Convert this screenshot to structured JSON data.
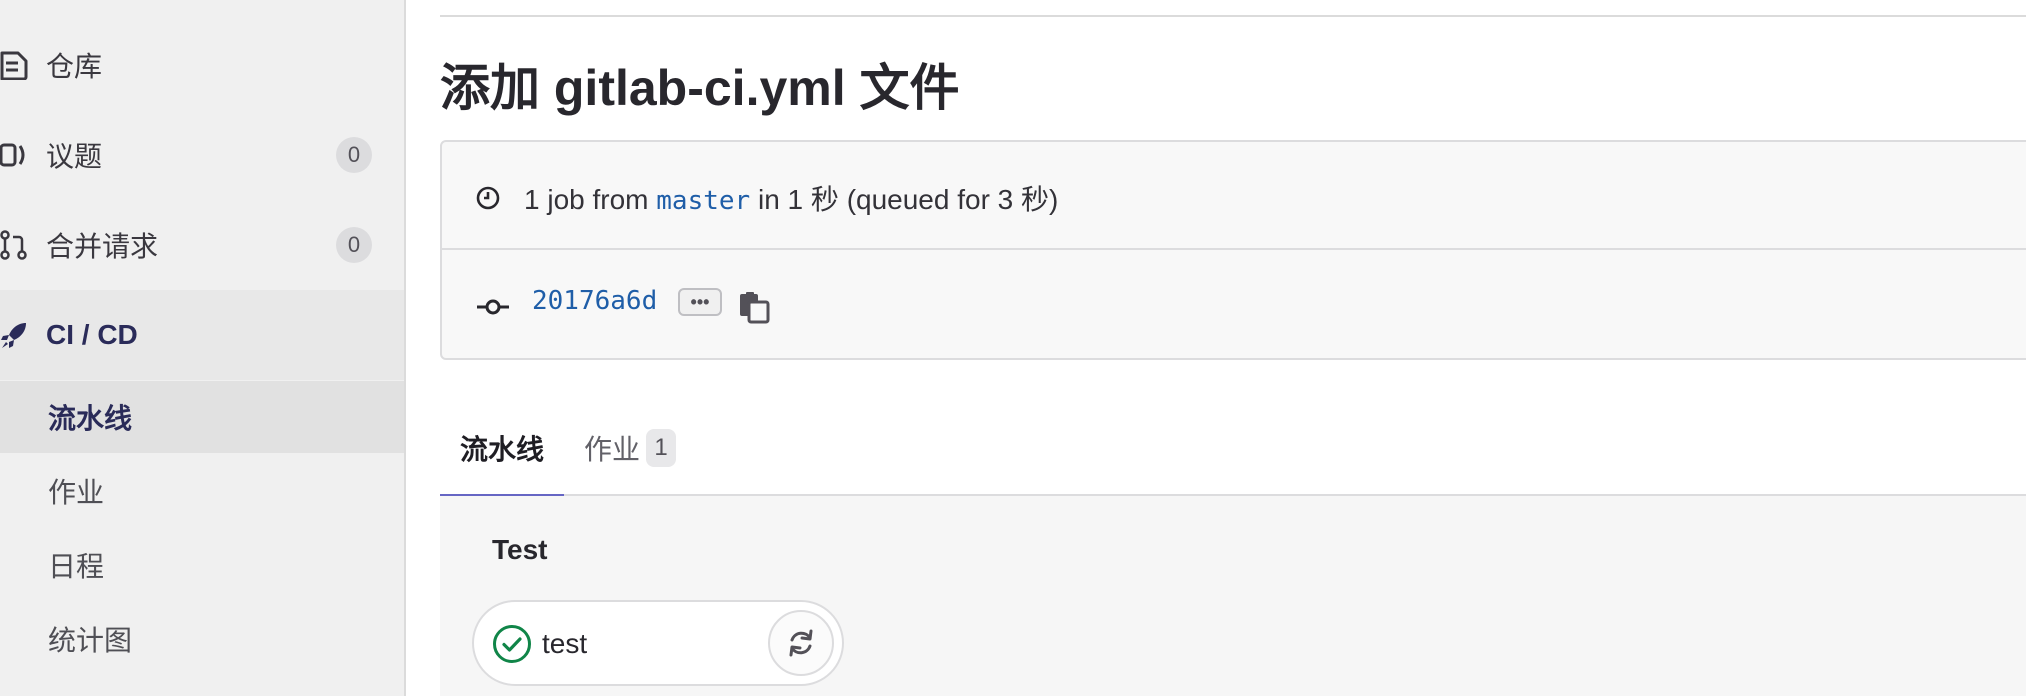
{
  "sidebar": {
    "items": [
      {
        "label": "仓库",
        "icon": "document-icon",
        "badge": null
      },
      {
        "label": "议题",
        "icon": "issues-icon",
        "badge": "0"
      },
      {
        "label": "合并请求",
        "icon": "merge-request-icon",
        "badge": "0"
      },
      {
        "label": "CI / CD",
        "icon": "rocket-icon",
        "badge": null,
        "active": true
      }
    ],
    "sub_items": [
      {
        "label": "流水线",
        "active": true
      },
      {
        "label": "作业"
      },
      {
        "label": "日程"
      },
      {
        "label": "统计图"
      }
    ]
  },
  "page": {
    "title": "添加 gitlab-ci.yml 文件"
  },
  "pipeline_info": {
    "summary_prefix": "1 job from",
    "branch": "master",
    "summary_suffix": "in 1 秒 (queued for 3 秒)",
    "commit_sha": "20176a6d",
    "ellipsis": "•••"
  },
  "tabs": [
    {
      "label": "流水线",
      "active": true
    },
    {
      "label": "作业",
      "count": "1"
    }
  ],
  "graph": {
    "stage_title": "Test",
    "job_name": "test",
    "job_status": "passed"
  },
  "colors": {
    "accent": "#6666c4",
    "link": "#1f5ea8",
    "success": "#108548",
    "nav_active": "#2a2b59"
  }
}
